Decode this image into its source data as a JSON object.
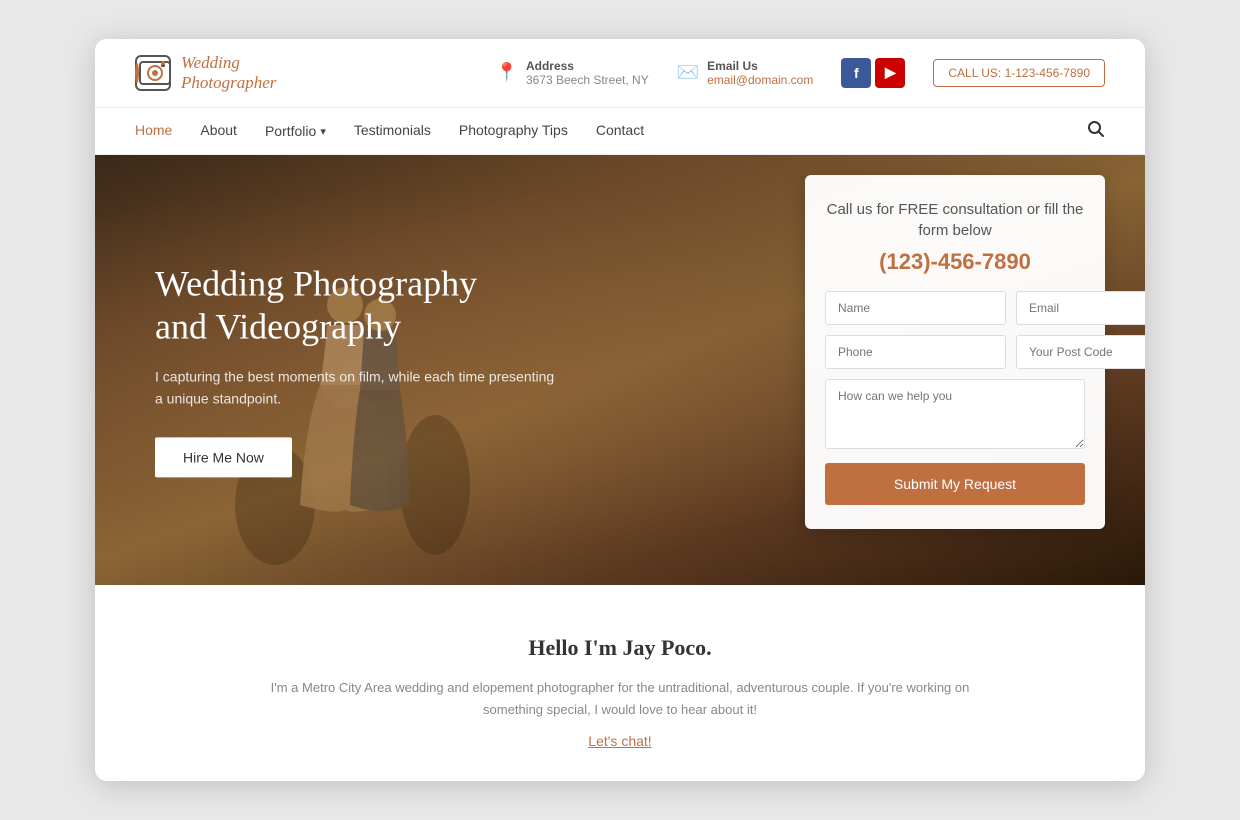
{
  "header": {
    "logo_line1": "Wedding",
    "logo_line2": "Photographer",
    "address_label": "Address",
    "address_value": "3673 Beech Street, NY",
    "email_label": "Email Us",
    "email_value": "email@domain.com",
    "call_btn": "CALL US: 1-123-456-7890",
    "facebook_label": "f",
    "youtube_label": "▶"
  },
  "nav": {
    "items": [
      {
        "label": "Home",
        "active": true,
        "dropdown": false
      },
      {
        "label": "About",
        "active": false,
        "dropdown": false
      },
      {
        "label": "Portfolio",
        "active": false,
        "dropdown": true
      },
      {
        "label": "Testimonials",
        "active": false,
        "dropdown": false
      },
      {
        "label": "Photography Tips",
        "active": false,
        "dropdown": false
      },
      {
        "label": "Contact",
        "active": false,
        "dropdown": false
      }
    ],
    "search_icon": "🔍"
  },
  "hero": {
    "title_line1": "Wedding Photography",
    "title_line2": "and Videography",
    "subtitle": "I capturing the best moments on film, while each time presenting a unique standpoint.",
    "hire_btn": "Hire Me Now"
  },
  "contact_card": {
    "heading": "Call us for FREE consultation or fill the form below",
    "phone": "(123)-456-7890",
    "name_placeholder": "Name",
    "email_placeholder": "Email",
    "phone_placeholder": "Phone",
    "postcode_placeholder": "Your Post Code",
    "message_placeholder": "How can we help you",
    "submit_btn": "Submit My Request"
  },
  "about": {
    "title": "Hello I'm Jay Poco.",
    "text": "I'm a Metro City Area wedding and elopement photographer for the untraditional, adventurous couple. If you're working on something special, I would love to hear about it!",
    "link_text": "Let's chat!"
  }
}
